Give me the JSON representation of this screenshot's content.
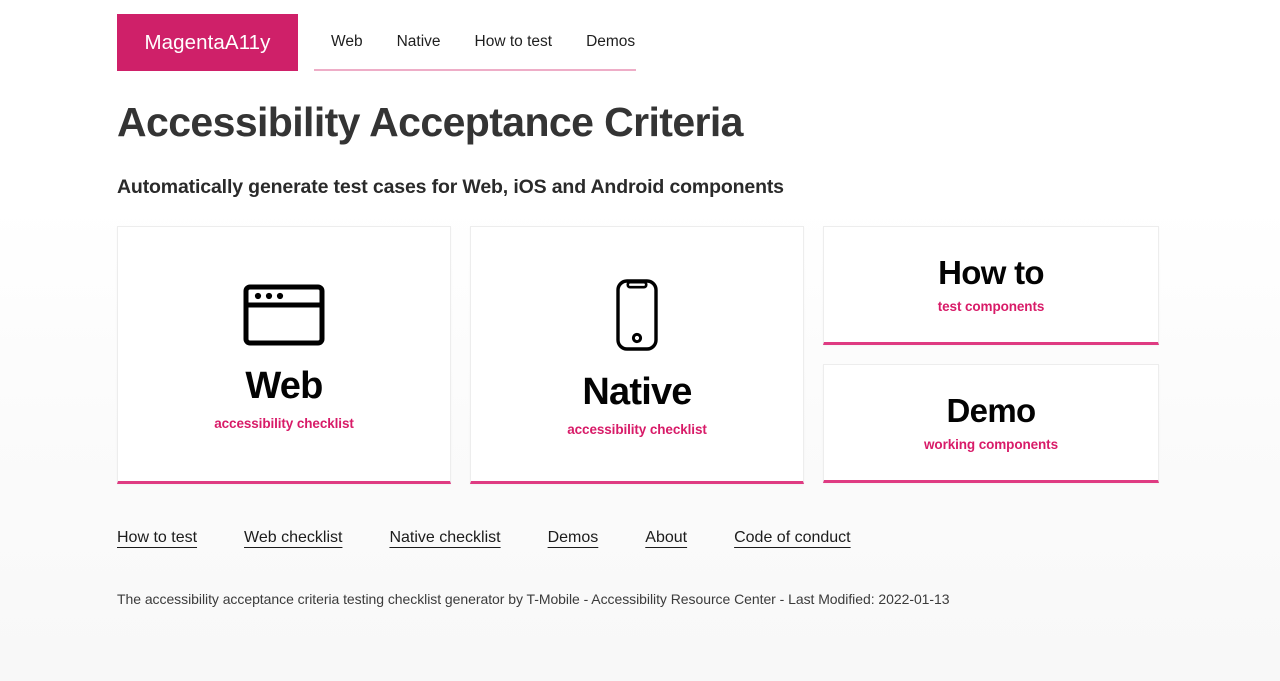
{
  "header": {
    "brand_label": "MagentaA11y",
    "nav_items": [
      {
        "label": "Web"
      },
      {
        "label": "Native"
      },
      {
        "label": "How to test"
      },
      {
        "label": "Demos"
      }
    ]
  },
  "main": {
    "title": "Accessibility Acceptance Criteria",
    "subtitle": "Automatically generate test cases for Web, iOS and Android components",
    "cards": [
      {
        "icon": "browser-window-icon",
        "title": "Web",
        "subtitle": "accessibility checklist"
      },
      {
        "icon": "mobile-phone-icon",
        "title": "Native",
        "subtitle": "accessibility checklist"
      },
      {
        "icon": "none",
        "title": "How to",
        "subtitle": "test components"
      },
      {
        "icon": "none",
        "title": "Demo",
        "subtitle": "working components"
      }
    ]
  },
  "footer": {
    "links": [
      {
        "label": "How to test"
      },
      {
        "label": "Web checklist"
      },
      {
        "label": "Native checklist"
      },
      {
        "label": "Demos"
      },
      {
        "label": "About"
      },
      {
        "label": "Code of conduct"
      }
    ],
    "note": "The accessibility acceptance criteria testing checklist generator by T-Mobile - Accessibility Resource Center - Last Modified: 2022‑01‑13"
  },
  "colors": {
    "brand_magenta": "#cf2069",
    "accent_magenta": "#d81b68",
    "card_border_bottom": "#df3b82",
    "nav_underline": "#eeadc7",
    "text_dark": "#343434",
    "page_background": "#ffffff"
  }
}
